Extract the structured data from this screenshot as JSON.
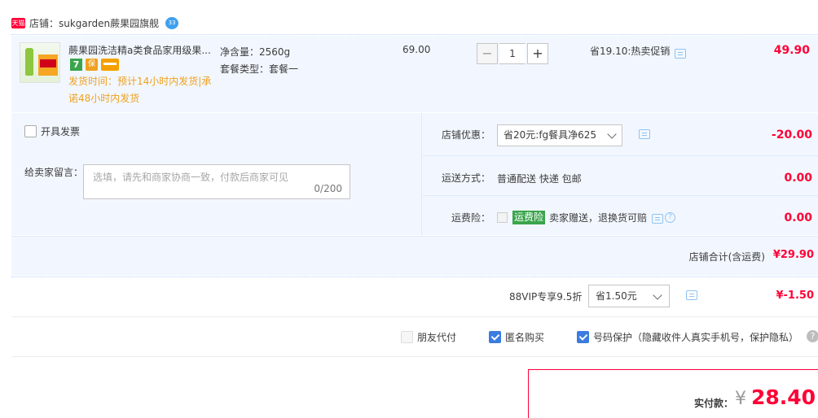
{
  "shop": {
    "badge": "天猫",
    "name": "店铺：sukgarden蕨果园旗舰",
    "chat_badge": "33"
  },
  "item": {
    "title": "蕨果园洗洁精a类食品家用级果...",
    "shipping_note": "发货时间：预计14小时内发货|承诺48小时内发货",
    "icon_seven": "7",
    "icon_bao": "保",
    "net_content": "净含量：2560g",
    "package_type": "套餐类型：套餐一",
    "unit_price": "69.00",
    "qty_minus": "−",
    "quantity": "1",
    "qty_plus": "+",
    "promo": "省19.10:热卖促销",
    "line_total": "49.90"
  },
  "invoice": {
    "label": "开具发票"
  },
  "memo": {
    "label": "给卖家留言：",
    "placeholder": "选填，请先和商家协商一致，付款后商家可见",
    "count": "0/200"
  },
  "store_discount": {
    "label": "店铺优惠：",
    "selected": "省20元:fg餐具净625",
    "amount": "-20.00"
  },
  "shipping": {
    "label": "运送方式：",
    "value": "普通配送 快递 包邮",
    "amount": "0.00"
  },
  "freight_insurance": {
    "label": "运费险：",
    "badge": "运费险",
    "text": "卖家赠送，退换货可赔",
    "help": "?",
    "amount": "0.00"
  },
  "subtotal": {
    "label": "店铺合计(含运费)",
    "amount": "¥29.90"
  },
  "vip": {
    "label": "88VIP专享9.5折",
    "selected": "省1.50元",
    "amount": "¥-1.50"
  },
  "options": {
    "friend_pay": "朋友代付",
    "anonymous": "匿名购买",
    "number_protect": "号码保护（隐藏收件人真实手机号，保护隐私）",
    "help": "?"
  },
  "payment": {
    "label": "实付款：",
    "currency": "¥",
    "amount": "28.40"
  },
  "colors": {
    "price_red": "#ff0036",
    "panel_bg": "#f2f7ff",
    "shipping_orange": "#f0a01e",
    "checkbox_blue": "#3b7ce0",
    "badge_green": "#3aa54c"
  },
  "icons": {
    "shop_chat": "chat-bubble-icon",
    "message": "message-icon",
    "help": "help-icon",
    "chevron": "chevron-down-icon"
  }
}
